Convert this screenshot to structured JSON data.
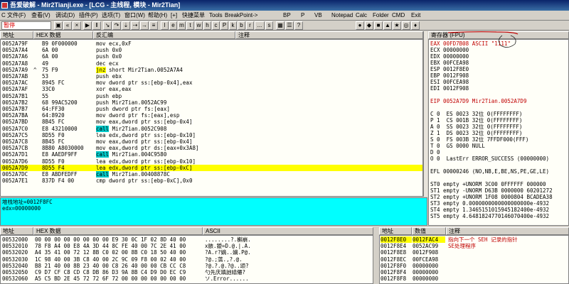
{
  "window": {
    "title": "吾爱破解 - Mir2Tianji.exe - [LCG - 主线程, 模块 - Mir2Tian]"
  },
  "menu": {
    "items": [
      "C 文件(F)",
      "查看(V)",
      "调试(D)",
      "插件(P)",
      "选项(T)",
      "窗口(W)",
      "帮助(H)",
      "[+]",
      "快捷菜单",
      "Tools",
      "BreakPoint->",
      "BP",
      "P",
      "VB",
      "Notepad",
      "Calc",
      "Folder",
      "CMD",
      "Exit"
    ]
  },
  "toolbar": {
    "status": "暂停",
    "letters": [
      "l",
      "e",
      "m",
      "t",
      "w",
      "h",
      "c",
      "P",
      "k",
      "b",
      "r",
      "...",
      "s"
    ]
  },
  "cpu": {
    "headers": {
      "addr": "地址",
      "hex": "HEX 数据",
      "disasm": "反汇编",
      "comment": "注释"
    },
    "rows": [
      {
        "a": "0052A79F",
        "h": "B9 0F000000",
        "d": "mov ecx,0xF",
        "m": "",
        "t": ""
      },
      {
        "a": "0052A7A4",
        "h": "6A 00",
        "d": "push 0x0",
        "m": "",
        "t": ""
      },
      {
        "a": "0052A7A6",
        "h": "6A 00",
        "d": "push 0x0",
        "m": "",
        "t": ""
      },
      {
        "a": "0052A7A8",
        "h": "49",
        "d": "dec ecx",
        "m": "",
        "t": ""
      },
      {
        "a": "0052A7A9",
        "h": "75 F9",
        "d": "jnz short Mir2Tian.0052A7A4",
        "m": "^",
        "t": "jnz"
      },
      {
        "a": "0052A7AB",
        "h": "53",
        "d": "push ebx",
        "m": "",
        "t": ""
      },
      {
        "a": "0052A7AC",
        "h": "8945 FC",
        "d": "mov dword ptr ss:[ebp-0x4],eax",
        "m": "",
        "t": ""
      },
      {
        "a": "0052A7AF",
        "h": "33C0",
        "d": "xor eax,eax",
        "m": "",
        "t": ""
      },
      {
        "a": "0052A7B1",
        "h": "55",
        "d": "push ebp",
        "m": "",
        "t": ""
      },
      {
        "a": "0052A7B2",
        "h": "68 99AC5200",
        "d": "push Mir2Tian.0052AC99",
        "m": "",
        "t": ""
      },
      {
        "a": "0052A7B7",
        "h": "64:FF30",
        "d": "push dword ptr fs:[eax]",
        "m": "",
        "t": ""
      },
      {
        "a": "0052A7BA",
        "h": "64:8920",
        "d": "mov dword ptr fs:[eax],esp",
        "m": "",
        "t": ""
      },
      {
        "a": "0052A7BD",
        "h": "8B45 FC",
        "d": "mov eax,dword ptr ss:[ebp-0x4]",
        "m": "",
        "t": ""
      },
      {
        "a": "0052A7C0",
        "h": "E8 43210000",
        "d": "call Mir2Tian.0052C908",
        "m": "",
        "t": "call"
      },
      {
        "a": "0052A7C5",
        "h": "8D55 F0",
        "d": "lea edx,dword ptr ss:[ebp-0x10]",
        "m": "",
        "t": ""
      },
      {
        "a": "0052A7C8",
        "h": "8B45 FC",
        "d": "mov eax,dword ptr ss:[ebp-0x4]",
        "m": "",
        "t": ""
      },
      {
        "a": "0052A7CB",
        "h": "8B80 A8030000",
        "d": "mov eax,dword ptr ds:[eax+0x3A8]",
        "m": "",
        "t": ""
      },
      {
        "a": "0052A7D1",
        "h": "E8 AAEDF9FF",
        "d": "call Mir2Tian.004C9580",
        "m": "",
        "t": "call"
      },
      {
        "a": "0052A7D6",
        "h": "8D55 F0",
        "d": "lea edx,dword ptr ss:[ebp-0x10]",
        "m": "",
        "t": ""
      },
      {
        "a": "0052A7D9",
        "h": "8D55 F4",
        "d": "lea edx,dword ptr ss:[ebp-0xC]",
        "m": "",
        "t": "sel"
      },
      {
        "a": "0052A7DC",
        "h": "E8 ABDFEDFF",
        "d": "call Mir2Tian.00408878C",
        "m": "",
        "t": "call"
      },
      {
        "a": "0052A7E1",
        "h": "837D F4 00",
        "d": "cmp dword ptr ss:[ebp-0xC],0x0",
        "m": "",
        "t": ""
      }
    ]
  },
  "info": {
    "line1": "堆栈地址=0012F8FC",
    "line2": "edx=00000000"
  },
  "registers": {
    "header": "寄存器 (FPU)",
    "lines": [
      "EAX 00FD7B08 ASCII \"1111\"",
      "ECX 00000000",
      "EDX 00000000",
      "EBX 00FCEA98",
      "ESP 0012F8E0",
      "EBP 0012F908",
      "ESI 00FCEA98",
      "EDI 0012F908",
      "",
      "EIP 0052A7D9 Mir2Tian.0052A7D9",
      "",
      "C 0  ES 0023 32位 0(FFFFFFFF)",
      "P 1  CS 001B 32位 0(FFFFFFFF)",
      "A 0  SS 0023 32位 0(FFFFFFFF)",
      "Z 1  DS 0023 32位 0(FFFFFFFF)",
      "S 0  FS 003B 32位 7FFDF000(FFF)",
      "T 0  GS 0000 NULL",
      "D 0",
      "O 0  LastErr ERROR_SUCCESS (00000000)",
      "",
      "EFL 00000246 (NO,NB,E,BE,NS,PE,GE,LE)",
      "",
      "ST0 empty +UNORM 3C00 0FFFFFF 000000",
      "ST1 empty -UNORM D63B 0000000 60201272",
      "ST2 empty +UNORM 1F08 0000804 BCADEA38",
      "ST3 empty 0.0000000000000000000e-4932",
      "ST4 empty 1.3465151015945182400e-4932",
      "ST5 empty 4.6481824770146070400e-4932"
    ]
  },
  "dump": {
    "headers": {
      "addr": "地址",
      "hex": "HEX 数据",
      "ascii": "ASCII"
    },
    "rows": [
      {
        "a": "00532000",
        "h": "00 00 00 00 00 00 00 00 E9 30 0C 1F 02 8D 40 00",
        "s": "........?.槲崩."
      },
      {
        "a": "00532010",
        "h": "78 F8 A4 00 E8 4A 3D 44 8C FE 40 00 7C 2E 41 00",
        "s": "x骸.鑀=D.@.|.A."
      },
      {
        "a": "00532020",
        "h": "A4 35 41 00 72 12 8B C0 02 00 8B C0 18 50 40 00",
        "s": "?A.r?嫡..嫡.P@."
      },
      {
        "a": "00532030",
        "h": "1C 98 40 00 3B C8 40 00 2C 9C 09 F8 00 02 40 00",
        "s": "?@.;薃.,?.@."
      },
      {
        "a": "00532040",
        "h": "B8 21 40 00 8B 23 40 00 C8 26 40 00 00 CB CC C8",
        "s": "?@.?.@.?@..颂?"
      },
      {
        "a": "00532050",
        "h": "C9 D7 CF C8 CD C8 DB 86 D3 9A 8B C4 D9 D0 EC C9",
        "s": "勺先庆蹎訑嬆僊?"
      },
      {
        "a": "00532060",
        "h": "A5 C5 BD 2E 45 72 72 6F 72 00 00 00 00 00 00 00",
        "s": "ソ.Error......"
      }
    ]
  },
  "stack": {
    "headers": {
      "addr": "地址",
      "val": "数值",
      "comment": "注释"
    },
    "rows": [
      {
        "a": "0012F8E0",
        "v": "0012FAC4",
        "c": "指向下一个 SEH 记录的指针",
        "sel": true
      },
      {
        "a": "0012F8E4",
        "v": "0052AC99",
        "c": "SE处理程序",
        "sel": false
      },
      {
        "a": "0012F8E8",
        "v": "0012F908",
        "c": "",
        "sel": false
      },
      {
        "a": "0012F8EC",
        "v": "00FCEA98",
        "c": "",
        "sel": false
      },
      {
        "a": "0012F8F0",
        "v": "00000000",
        "c": "",
        "sel": false
      },
      {
        "a": "0012F8F4",
        "v": "00000000",
        "c": "",
        "sel": false
      },
      {
        "a": "0012F8F8",
        "v": "00000000",
        "c": "",
        "sel": false
      }
    ]
  },
  "colors": {
    "selection": "#ffff00",
    "call": "#00c8c8",
    "info": "#00ffff",
    "red": "#c00000"
  }
}
